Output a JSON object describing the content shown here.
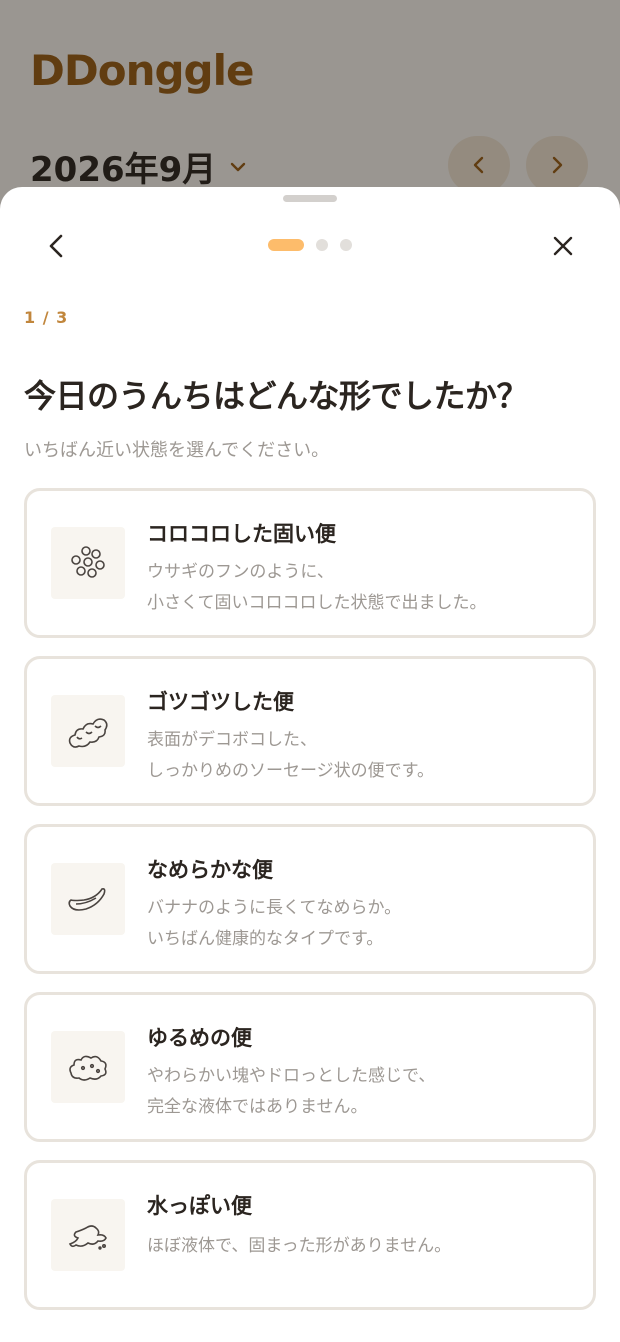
{
  "app": {
    "logo": "DDonggle",
    "month_label": "2026年9月"
  },
  "sheet": {
    "step_counter": "1 / 3",
    "question": "今日のうんちはどんな形でしたか？",
    "subtext": "いちばん近い状態を選んでください。",
    "progress": {
      "current": 1,
      "total": 3
    },
    "options": [
      {
        "title": "コロコロした固い便",
        "desc": [
          "ウサギのフンのように、",
          "小さくて固いコロコロした状態で出ました。"
        ],
        "icon": "pellets-icon"
      },
      {
        "title": "ゴツゴツした便",
        "desc": [
          "表面がデコボコした、",
          "しっかりめのソーセージ状の便です。"
        ],
        "icon": "lumpy-sausage-icon"
      },
      {
        "title": "なめらかな便",
        "desc": [
          "バナナのように長くてなめらか。",
          "いちばん健康的なタイプです。"
        ],
        "icon": "smooth-banana-icon"
      },
      {
        "title": "ゆるめの便",
        "desc": [
          "やわらかい塊やドロっとした感じで、",
          "完全な液体ではありません。"
        ],
        "icon": "soft-blob-icon"
      },
      {
        "title": "水っぽい便",
        "desc": [
          "ほぼ液体で、固まった形がありません。"
        ],
        "icon": "watery-splash-icon"
      }
    ]
  },
  "colors": {
    "accent": "#fdbc6b",
    "step_counter": "#c1863c",
    "logo": "#9a5d16",
    "card_border": "#e8e3dc"
  }
}
